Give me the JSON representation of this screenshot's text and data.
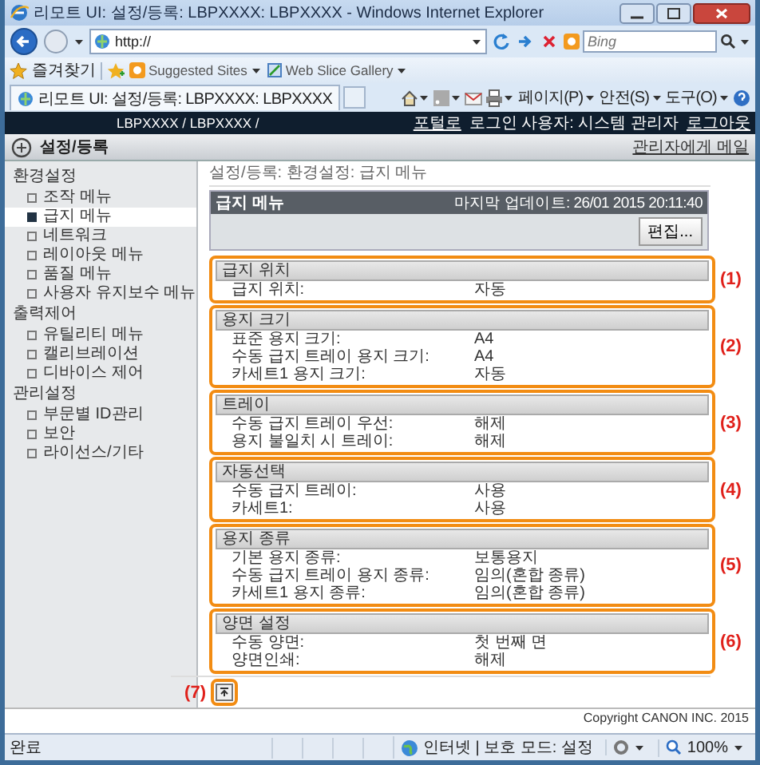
{
  "window": {
    "title": "리모트 UI: 설정/등록: LBPXXXX: LBPXXXX - Windows Internet Explorer"
  },
  "address_bar": {
    "url": "http://"
  },
  "search": {
    "placeholder": "Bing"
  },
  "favorites_bar": {
    "label": "즐겨찾기",
    "items": [
      "Suggested Sites",
      "Web Slice Gallery"
    ]
  },
  "tab": {
    "title": "리모트 UI: 설정/등록: LBPXXXX: LBPXXXX"
  },
  "command_bar": {
    "items": [
      "페이지(P)",
      "안전(S)",
      "도구(O)"
    ]
  },
  "site_header": {
    "device": "LBPXXXX / LBPXXXX /",
    "portal_link": "포털로",
    "user": "로그인 사용자: 시스템 관리자",
    "logout_link": "로그아웃"
  },
  "page_header": {
    "title": "설정/등록",
    "mail_link": "관리자에게 메일"
  },
  "sidebar": {
    "groups": [
      {
        "label": "환경설정",
        "items": [
          {
            "label": "조작 메뉴",
            "selected": false
          },
          {
            "label": "급지 메뉴",
            "selected": true
          },
          {
            "label": "네트워크",
            "selected": false
          },
          {
            "label": "레이아웃 메뉴",
            "selected": false
          },
          {
            "label": "품질 메뉴",
            "selected": false
          },
          {
            "label": "사용자 유지보수 메뉴",
            "selected": false
          }
        ]
      },
      {
        "label": "출력제어",
        "items": [
          {
            "label": "유틸리티 메뉴",
            "selected": false
          },
          {
            "label": "캘리브레이션",
            "selected": false
          },
          {
            "label": "디바이스 제어",
            "selected": false
          }
        ]
      },
      {
        "label": "관리설정",
        "items": [
          {
            "label": "부문별 ID관리",
            "selected": false
          },
          {
            "label": "보안",
            "selected": false
          },
          {
            "label": "라이선스/기타",
            "selected": false
          }
        ]
      }
    ]
  },
  "breadcrumb": "설정/등록: 환경설정: 급지 메뉴",
  "panel": {
    "title": "급지 메뉴",
    "last_update": "마지막 업데이트: 26/01 2015 20:11:40",
    "edit_button": "편집..."
  },
  "sections": [
    {
      "title": "급지 위치",
      "callout": "(1)",
      "rows": [
        {
          "label": "급지 위치:",
          "value": "자동"
        }
      ]
    },
    {
      "title": "용지 크기",
      "callout": "(2)",
      "rows": [
        {
          "label": "표준 용지 크기:",
          "value": "A4"
        },
        {
          "label": "수동 급지 트레이 용지 크기:",
          "value": "A4"
        },
        {
          "label": "카세트1 용지 크기:",
          "value": "자동"
        }
      ]
    },
    {
      "title": "트레이",
      "callout": "(3)",
      "rows": [
        {
          "label": "수동 급지 트레이 우선:",
          "value": "해제"
        },
        {
          "label": "용지 불일치 시 트레이:",
          "value": "해제"
        }
      ]
    },
    {
      "title": "자동선택",
      "callout": "(4)",
      "rows": [
        {
          "label": "수동 급지 트레이:",
          "value": "사용"
        },
        {
          "label": "카세트1:",
          "value": "사용"
        }
      ]
    },
    {
      "title": "용지 종류",
      "callout": "(5)",
      "rows": [
        {
          "label": "기본 용지 종류:",
          "value": "보통용지"
        },
        {
          "label": "수동 급지 트레이 용지 종류:",
          "value": "임의(혼합 종류)"
        },
        {
          "label": "카세트1 용지 종류:",
          "value": "임의(혼합 종류)"
        }
      ]
    },
    {
      "title": "양면 설정",
      "callout": "(6)",
      "rows": [
        {
          "label": "수동 양면:",
          "value": "첫 번째 면"
        },
        {
          "label": "양면인쇄:",
          "value": "해제"
        }
      ]
    }
  ],
  "top_button": {
    "callout": "(7)"
  },
  "copyright": "Copyright CANON INC. 2015",
  "status_bar": {
    "text": "완료",
    "zone": "인터넷 | 보호 모드: 설정",
    "zoom": "100%"
  }
}
